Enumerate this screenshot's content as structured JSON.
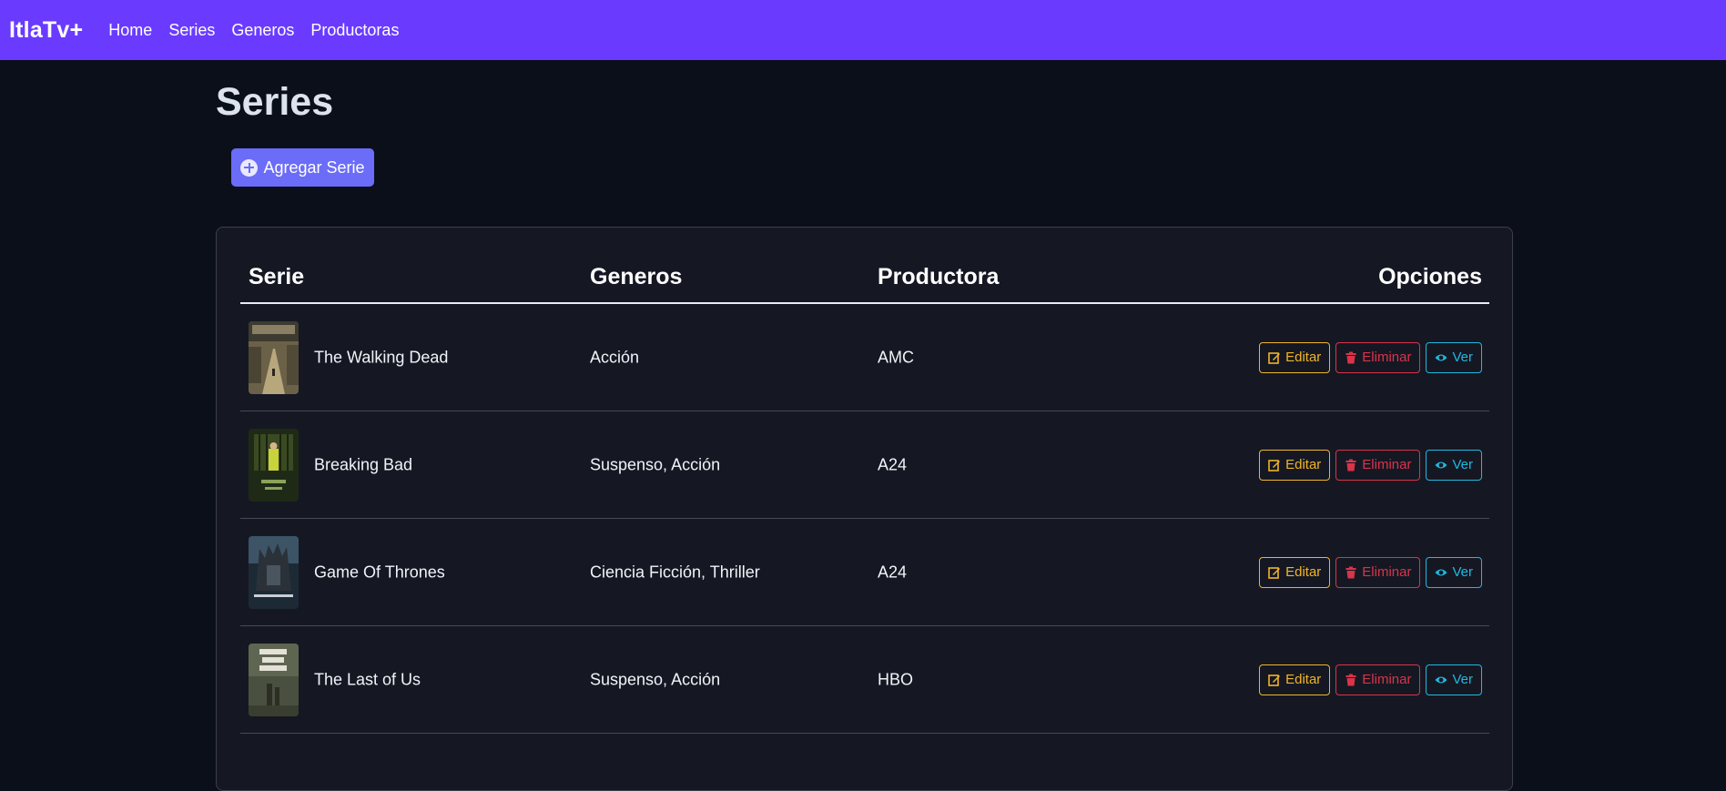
{
  "navbar": {
    "brand": "ItlaTv+",
    "links": [
      "Home",
      "Series",
      "Generos",
      "Productoras"
    ],
    "color": "#6a3bff"
  },
  "page": {
    "title": "Series",
    "add_button": "Agregar Serie"
  },
  "table": {
    "headers": {
      "serie": "Serie",
      "generos": "Generos",
      "productora": "Productora",
      "opciones": "Opciones"
    },
    "action_labels": {
      "edit": "Editar",
      "delete": "Eliminar",
      "view": "Ver"
    },
    "rows": [
      {
        "serie": "The Walking Dead",
        "generos": "Acción",
        "productora": "AMC"
      },
      {
        "serie": "Breaking Bad",
        "generos": "Suspenso, Acción",
        "productora": "A24"
      },
      {
        "serie": "Game Of Thrones",
        "generos": "Ciencia Ficción, Thriller",
        "productora": "A24"
      },
      {
        "serie": "The Last of Us",
        "generos": "Suspenso, Acción",
        "productora": "HBO"
      }
    ]
  },
  "colors": {
    "background": "#0b0f1a",
    "card": "#151823",
    "primary": "#6b6cf7",
    "edit": "#f0b429",
    "delete": "#d9344a",
    "view": "#22b8e0"
  }
}
